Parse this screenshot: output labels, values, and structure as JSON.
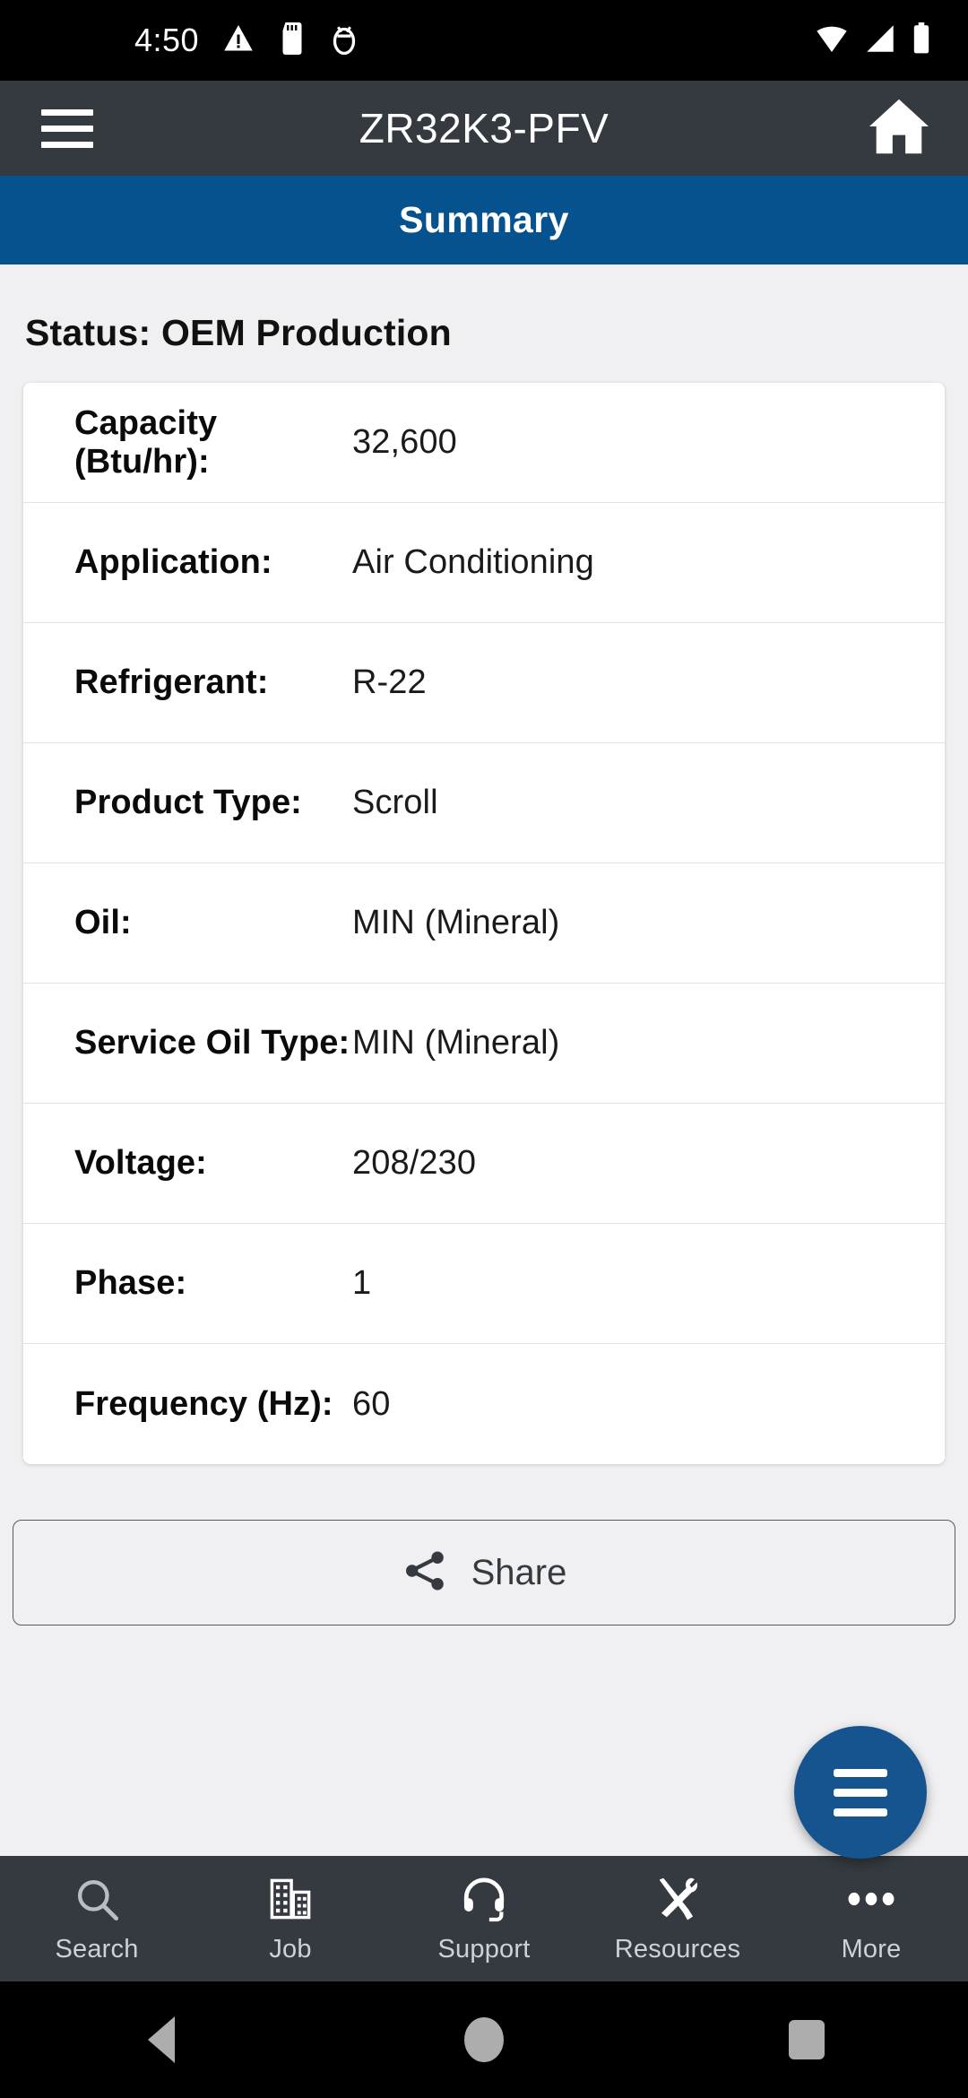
{
  "statusbar": {
    "time": "4:50",
    "left_icons": [
      "warning-triangle-icon",
      "sd-card-icon",
      "usb-debug-icon"
    ],
    "right_icons": [
      "wifi-icon",
      "cell-signal-icon",
      "battery-icon"
    ]
  },
  "appbar": {
    "menu_icon": "hamburger-menu-icon",
    "title": "ZR32K3-PFV",
    "home_icon": "home-icon"
  },
  "section": {
    "title": "Summary"
  },
  "main": {
    "status_line": "Status: OEM Production",
    "spec_rows": [
      {
        "label": "Capacity (Btu/hr):",
        "value": "32,600"
      },
      {
        "label": "Application:",
        "value": "Air Conditioning"
      },
      {
        "label": "Refrigerant:",
        "value": "R-22"
      },
      {
        "label": "Product Type:",
        "value": "Scroll"
      },
      {
        "label": "Oil:",
        "value": "MIN (Mineral)"
      },
      {
        "label": "Service Oil Type:",
        "value": "MIN (Mineral)"
      },
      {
        "label": "Voltage:",
        "value": "208/230"
      },
      {
        "label": "Phase:",
        "value": "1"
      },
      {
        "label": "Frequency (Hz):",
        "value": "60"
      }
    ],
    "share_button": {
      "label": "Share",
      "icon": "share-icon"
    },
    "fab": {
      "icon": "menu-lines-icon"
    }
  },
  "tabbar": {
    "items": [
      {
        "label": "Search",
        "icon": "search-icon"
      },
      {
        "label": "Job",
        "icon": "building-icon"
      },
      {
        "label": "Support",
        "icon": "headset-icon"
      },
      {
        "label": "Resources",
        "icon": "tools-icon"
      },
      {
        "label": "More",
        "icon": "ellipsis-icon"
      }
    ]
  },
  "navbar": {
    "back": "back-triangle-icon",
    "home": "home-circle-icon",
    "recents": "recents-square-icon"
  },
  "colors": {
    "appbar": "#343a40",
    "accent_blue": "#06528f",
    "fab_blue": "#15548f",
    "page_bg": "#f0f0f2",
    "card_bg": "#ffffff"
  }
}
